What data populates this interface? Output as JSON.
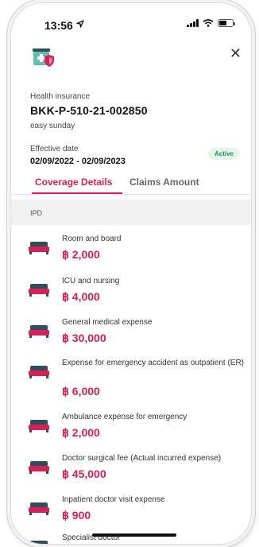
{
  "status": {
    "time": "13:56"
  },
  "policy": {
    "type_label": "Health insurance",
    "number": "BKK-P-510-21-002850",
    "plan_name": "easy sunday",
    "effective_label": "Effective date",
    "dates": "02/09/2022 - 02/09/2023",
    "status": "Active"
  },
  "tabs": [
    {
      "label": "Coverage Details",
      "active": true
    },
    {
      "label": "Claims Amount",
      "active": false
    }
  ],
  "section": {
    "label": "IPD"
  },
  "coverage": [
    {
      "title": "Room and board",
      "amount": "฿ 2,000"
    },
    {
      "title": "ICU and nursing",
      "amount": "฿ 4,000"
    },
    {
      "title": "General medical expense",
      "amount": "฿ 30,000"
    },
    {
      "title": "Expense for emergency accident as outpatient (ER)",
      "amount": "฿ 6,000"
    },
    {
      "title": "Ambulance expense for emergency",
      "amount": "฿ 2,000"
    },
    {
      "title": "Doctor surgical fee (Actual incurred expense)",
      "amount": "฿ 45,000"
    },
    {
      "title": "Inpatient doctor visit expense",
      "amount": "฿ 900"
    },
    {
      "title": "Specialist doctor",
      "amount": ""
    }
  ],
  "colors": {
    "accent": "#d81f57",
    "icon_teal": "#5fbfb4",
    "active_badge": "#2e8b57"
  },
  "icons": {
    "header": "medical-box-shield-icon",
    "close": "close-icon",
    "item": "hospital-bed-icon"
  }
}
